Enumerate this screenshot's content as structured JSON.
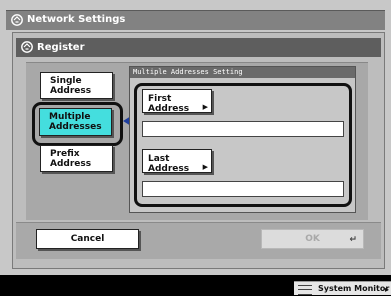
{
  "window": {
    "title": "Network Settings"
  },
  "dialog": {
    "title": "Register"
  },
  "options": [
    {
      "label_line1": "Single",
      "label_line2": "Address"
    },
    {
      "label_line1": "Multiple",
      "label_line2": "Addresses"
    },
    {
      "label_line1": "Prefix",
      "label_line2": "Address"
    }
  ],
  "panel": {
    "header": "Multiple Addresses Setting",
    "first_address_label": "First Address",
    "first_address_value": "",
    "last_address_label": "Last Address",
    "last_address_value": ""
  },
  "footer": {
    "cancel_label": "Cancel",
    "ok_label": "OK",
    "ok_icon": "return-icon"
  },
  "status_bar": {
    "system_monitor_label": "System Monitor"
  },
  "colors": {
    "selected": "#44dede",
    "title_bar": "#828282",
    "header": "#5e5e5e"
  }
}
